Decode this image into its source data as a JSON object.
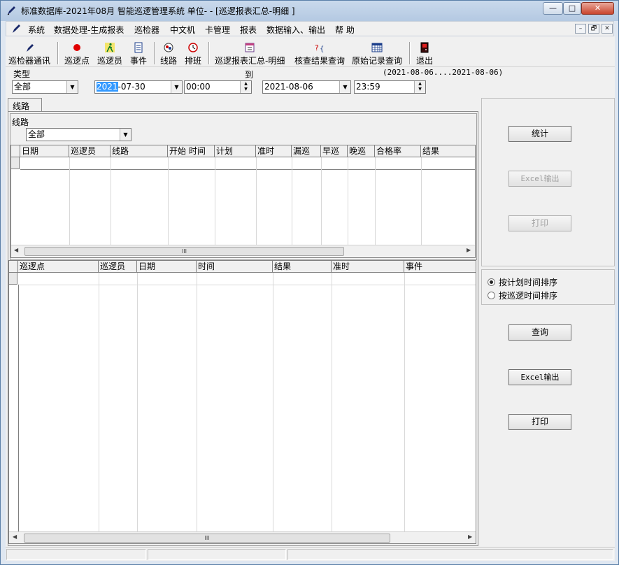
{
  "window": {
    "title": "标准数据库-2021年08月  智能巡逻管理系统    单位- - [巡逻报表汇总-明细 ]",
    "controls": {
      "minimize": "—",
      "maximize": "□",
      "close": "✕"
    }
  },
  "menu": {
    "items": [
      "系统",
      "数据处理-生成报表",
      "巡检器",
      "中文机",
      "卡管理",
      "报表",
      "数据输入、输出",
      "帮 助"
    ],
    "mdi_controls": [
      "–",
      "🗗",
      "✕"
    ]
  },
  "toolbar": {
    "items": [
      "巡检器通讯",
      "巡逻点",
      "巡逻员",
      "事件",
      "线路",
      "排班",
      "巡逻报表汇总-明细",
      "核查结果查询",
      "原始记录查询",
      "退出"
    ]
  },
  "filters": {
    "type_label": "类型",
    "type_value": "全部",
    "to_label": "到",
    "range_text": "(2021-08-06....2021-08-06)",
    "start_date_selected": "2021",
    "start_date_rest": "-07-30",
    "start_time": "00:00",
    "end_date": "2021-08-06",
    "end_time": "23:59"
  },
  "tab": {
    "label": "线路"
  },
  "route": {
    "label": "线路",
    "value": "全部"
  },
  "grid1": {
    "columns": [
      "日期",
      "巡逻员",
      "线路",
      "开始 时间",
      "计划",
      "准时",
      "漏巡",
      "早巡",
      "晚巡",
      "合格率",
      "结果"
    ]
  },
  "grid2": {
    "columns": [
      "巡逻点",
      "巡逻员",
      "日期",
      "时间",
      "结果",
      "准时",
      "事件"
    ]
  },
  "scroll_thumb_text": "III",
  "right_panel": {
    "stats_button": "统计",
    "excel_button_top": "Excel输出",
    "print_button_top": "打印",
    "sort_options": [
      {
        "label": "按计划时间排序",
        "checked": true
      },
      {
        "label": "按巡逻时间排序",
        "checked": false
      }
    ],
    "query_button": "查询",
    "excel_button": "Excel输出",
    "print_button": "打印"
  }
}
